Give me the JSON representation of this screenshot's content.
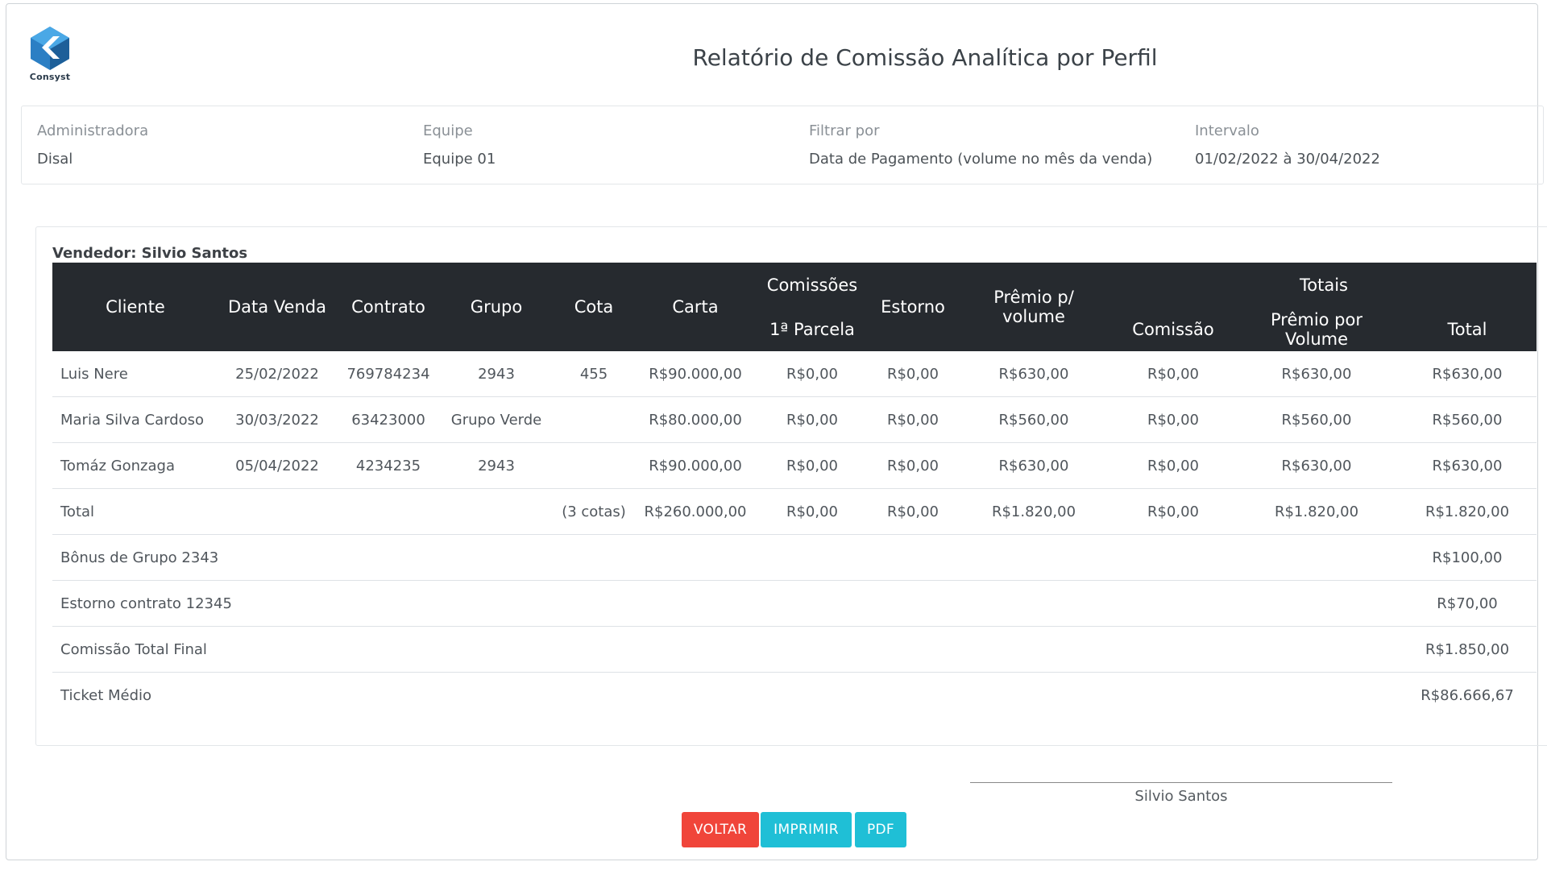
{
  "header": {
    "logo_text": "Consyst",
    "title": "Relatório de Comissão Analítica por Perfil"
  },
  "filters": [
    {
      "label": "Administradora",
      "value": "Disal"
    },
    {
      "label": "Equipe",
      "value": "Equipe 01"
    },
    {
      "label": "Filtrar por",
      "value": "Data de Pagamento (volume no mês da venda)"
    },
    {
      "label": "Intervalo",
      "value": "01/02/2022 à 30/04/2022"
    }
  ],
  "report": {
    "seller": "Vendedor: Silvio Santos",
    "columns": {
      "cliente": "Cliente",
      "data_venda": "Data Venda",
      "contrato": "Contrato",
      "grupo": "Grupo",
      "cota": "Cota",
      "carta": "Carta",
      "comissoes": "Comissões",
      "parcela1": "1ª Parcela",
      "estorno": "Estorno",
      "premio_volume": "Prêmio p/ volume",
      "totais": "Totais",
      "comissao": "Comissão",
      "premio_por_volume": "Prêmio por Volume",
      "total": "Total"
    },
    "rows": [
      {
        "cliente": "Luis Nere",
        "data": "25/02/2022",
        "contrato": "769784234",
        "grupo": "2943",
        "cota": "455",
        "carta": "R$90.000,00",
        "parcela": "R$0,00",
        "estorno": "R$0,00",
        "premio": "R$630,00",
        "comissao": "R$0,00",
        "premio_total": "R$630,00",
        "total": "R$630,00"
      },
      {
        "cliente": "Maria Silva Cardoso",
        "data": "30/03/2022",
        "contrato": "63423000",
        "grupo": "Grupo Verde",
        "cota": "",
        "carta": "R$80.000,00",
        "parcela": "R$0,00",
        "estorno": "R$0,00",
        "premio": "R$560,00",
        "comissao": "R$0,00",
        "premio_total": "R$560,00",
        "total": "R$560,00"
      },
      {
        "cliente": "Tomáz Gonzaga",
        "data": "05/04/2022",
        "contrato": "4234235",
        "grupo": "2943",
        "cota": "",
        "carta": "R$90.000,00",
        "parcela": "R$0,00",
        "estorno": "R$0,00",
        "premio": "R$630,00",
        "comissao": "R$0,00",
        "premio_total": "R$630,00",
        "total": "R$630,00"
      }
    ],
    "total_row": {
      "label": "Total",
      "cotas": "(3 cotas)",
      "carta": "R$260.000,00",
      "parcela": "R$0,00",
      "estorno": "R$0,00",
      "premio": "R$1.820,00",
      "comissao": "R$0,00",
      "premio_total": "R$1.820,00",
      "total": "R$1.820,00"
    },
    "summary": [
      {
        "label": "Bônus de Grupo 2343",
        "value": "R$100,00"
      },
      {
        "label": "Estorno contrato 12345",
        "value": "R$70,00"
      },
      {
        "label": "Comissão Total Final",
        "value": "R$1.850,00"
      },
      {
        "label": "Ticket Médio",
        "value": "R$86.666,67"
      }
    ]
  },
  "signature": {
    "name": "Silvio Santos"
  },
  "buttons": {
    "voltar": "VOLTAR",
    "imprimir": "IMPRIMIR",
    "pdf": "PDF"
  },
  "colors": {
    "header_bg": "#262a2f",
    "danger": "#f0453a",
    "info": "#1fbfd6"
  }
}
